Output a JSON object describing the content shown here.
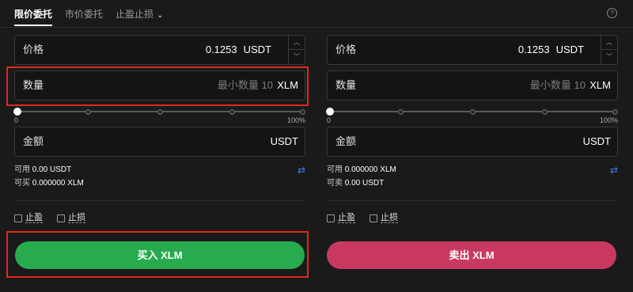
{
  "tabs": {
    "limit": "限价委托",
    "market": "市价委托",
    "tpsl": "止盈止损"
  },
  "help_icon": "help-circle-icon",
  "buy": {
    "price_label": "价格",
    "price_value": "0.1253",
    "price_unit": "USDT",
    "qty_label": "数量",
    "qty_placeholder": "最小数量 10",
    "qty_unit": "XLM",
    "slider_min": "0",
    "slider_max": "100%",
    "slider_value": 0,
    "amount_label": "金额",
    "amount_unit": "USDT",
    "available_label": "可用",
    "available_value": "0.00 USDT",
    "max_label": "可买",
    "max_value": "0.000000 XLM",
    "take_profit": "止盈",
    "stop_loss": "止损",
    "button": "买入 XLM"
  },
  "sell": {
    "price_label": "价格",
    "price_value": "0.1253",
    "price_unit": "USDT",
    "qty_label": "数量",
    "qty_placeholder": "最小数量 10",
    "qty_unit": "XLM",
    "slider_min": "0",
    "slider_max": "100%",
    "slider_value": 0,
    "amount_label": "金额",
    "amount_unit": "USDT",
    "available_label": "可用",
    "available_value": "0.000000 XLM",
    "max_label": "可卖",
    "max_value": "0.00 USDT",
    "take_profit": "止盈",
    "stop_loss": "止损",
    "button": "卖出 XLM"
  },
  "colors": {
    "buy": "#27ab4e",
    "sell": "#c9395f",
    "highlight": "#e0291c",
    "swap": "#3c7cf0"
  }
}
